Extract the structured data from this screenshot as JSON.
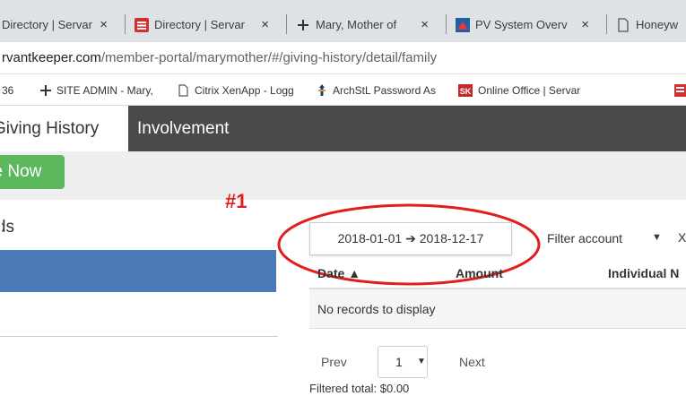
{
  "browser": {
    "tabs": [
      {
        "title": "Directory | Servar",
        "icon": "page-icon",
        "close": "×"
      },
      {
        "title": "Directory | Servar",
        "icon": "servantkeeper-icon",
        "close": "×"
      },
      {
        "title": "Mary, Mother of",
        "icon": "cross-icon",
        "close": "×"
      },
      {
        "title": "PV System Overv",
        "icon": "pv-system-icon",
        "close": "×"
      },
      {
        "title": "Honeyw",
        "icon": "page-icon"
      }
    ],
    "url": {
      "host": "rvantkeeper.com",
      "path": "/member-portal/marymother/#/giving-history/detail/family"
    },
    "bookmarks": [
      {
        "label": "36",
        "icon": ""
      },
      {
        "label": "SITE ADMIN - Mary,",
        "icon": "cross-icon"
      },
      {
        "label": "Citrix XenApp - Logg",
        "icon": "page-icon"
      },
      {
        "label": "ArchStL Password As",
        "icon": "archstl-icon"
      },
      {
        "label": "Online Office | Servar",
        "icon": "sk-icon",
        "badge": "SK"
      },
      {
        "label": "",
        "icon": "servantkeeper-icon"
      }
    ]
  },
  "nav": {
    "giving_history": "Giving History",
    "involvement": "Involvement"
  },
  "toolbar": {
    "give_now": "Give Now"
  },
  "left_panel": {
    "heading": "Funds"
  },
  "annotation": {
    "label": "#1",
    "color": "#e01e1e"
  },
  "filters": {
    "date_start": "2018-01-01",
    "date_arrow": "➔",
    "date_end": "2018-12-17",
    "account_placeholder": "Filter account",
    "account_caret": "▼",
    "clear": "X"
  },
  "table": {
    "columns": [
      "Date ▲",
      "Amount",
      "Individual N"
    ],
    "empty_message": "No records to display"
  },
  "pager": {
    "prev": "Prev",
    "page": "1",
    "caret": "▼",
    "next": "Next"
  },
  "summary": {
    "filtered_total": "Filtered total: $0.00"
  },
  "colors": {
    "nav_bg": "#4a4a4a",
    "give_button": "#5cb85c",
    "selected_row": "#4a7ab8"
  }
}
